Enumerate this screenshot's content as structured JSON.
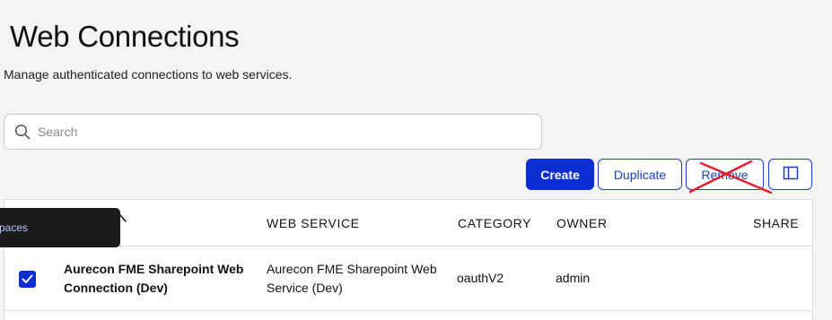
{
  "header": {
    "title": "Web Connections",
    "subtitle": "Manage authenticated connections to web services."
  },
  "search": {
    "placeholder": "Search",
    "value": ""
  },
  "toolbar": {
    "create_label": "Create",
    "duplicate_label": "Duplicate",
    "remove_label": "Remove",
    "columns_icon": "columns-icon"
  },
  "table": {
    "columns": [
      "WEB SERVICE",
      "CATEGORY",
      "OWNER",
      "SHARE"
    ],
    "rows": [
      {
        "selected": true,
        "name": "Aurecon FME Sharepoint Web Connection (Dev)",
        "web_service": "Aurecon FME Sharepoint Web Service (Dev)",
        "category": "oauthV2",
        "owner": "admin",
        "share": ""
      }
    ]
  },
  "tooltip": {
    "text": "paces"
  },
  "colors": {
    "primary": "#0a2ed1",
    "outline": "#1a3fc8",
    "annotation_cross": "#e0202a",
    "tooltip_bg": "#1b1b1b"
  }
}
